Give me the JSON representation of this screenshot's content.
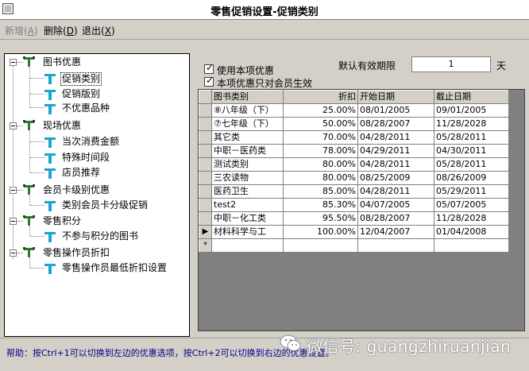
{
  "window": {
    "title": "零售促销设置-促销类别"
  },
  "menu": [
    {
      "label": "新增",
      "key": "A",
      "disabled": true
    },
    {
      "label": "删除",
      "key": "D",
      "disabled": false
    },
    {
      "label": "退出",
      "key": "X",
      "disabled": false
    }
  ],
  "tree": {
    "groups": [
      {
        "label": "图书优惠",
        "children": [
          "促销类别",
          "促销版别",
          "不优惠品种"
        ]
      },
      {
        "label": "现场优惠",
        "children": [
          "当次消费金额",
          "特殊时间段",
          "店员推荐"
        ]
      },
      {
        "label": "会员卡级别优惠",
        "children": [
          "类别会员卡分级促销"
        ]
      },
      {
        "label": "零售积分",
        "children": [
          "不参与积分的图书"
        ]
      },
      {
        "label": "零售操作员折扣",
        "children": [
          "零售操作员最低折扣设置"
        ]
      }
    ],
    "selected": "促销类别"
  },
  "options": {
    "use_promo_label": "使用本项优惠",
    "member_only_label": "本项优惠只对会员生效",
    "use_promo_checked": true,
    "member_only_checked": true,
    "valid_days_label": "默认有效期限",
    "valid_days_value": "1",
    "valid_days_unit": "天"
  },
  "grid": {
    "columns": [
      "图书类别",
      "折扣",
      "开始日期",
      "截止日期"
    ],
    "rows": [
      [
        "⑧八年级（下）",
        "25.00%",
        "08/01/2005",
        "09/01/2005"
      ],
      [
        "⑦七年级（下）",
        "50.00%",
        "08/28/2007",
        "11/28/2028"
      ],
      [
        "其它类",
        "70.00%",
        "04/28/2011",
        "05/28/2011"
      ],
      [
        "中职－医药类",
        "78.00%",
        "04/29/2011",
        "04/30/2011"
      ],
      [
        "测试类别",
        "80.00%",
        "04/28/2011",
        "05/28/2011"
      ],
      [
        "三农读物",
        "80.00%",
        "08/25/2009",
        "08/26/2009"
      ],
      [
        "医药卫生",
        "85.00%",
        "04/28/2011",
        "05/29/2011"
      ],
      [
        "test2",
        "85.30%",
        "04/07/2005",
        "05/07/2005"
      ],
      [
        "中职－化工类",
        "95.50%",
        "08/28/2007",
        "11/28/2028"
      ],
      [
        "材料科学与工",
        "100.00%",
        "12/04/2007",
        "01/04/2008"
      ]
    ],
    "current_row_marker": "▶",
    "new_row_marker": "*"
  },
  "help": {
    "text": "帮助：按Ctrl+1可以切换到左边的优惠选项，按Ctrl+2可以切换到右边的优惠设置。"
  },
  "watermark": {
    "text": "微信号: guangzhiruanjian"
  },
  "colors": {
    "help_text": "#00008b",
    "tree_group_icon": "#2c7a2c",
    "tree_leaf_icon": "#1aa6d0"
  },
  "icons": {
    "group": "green-t-icon",
    "leaf": "cyan-t-icon"
  }
}
